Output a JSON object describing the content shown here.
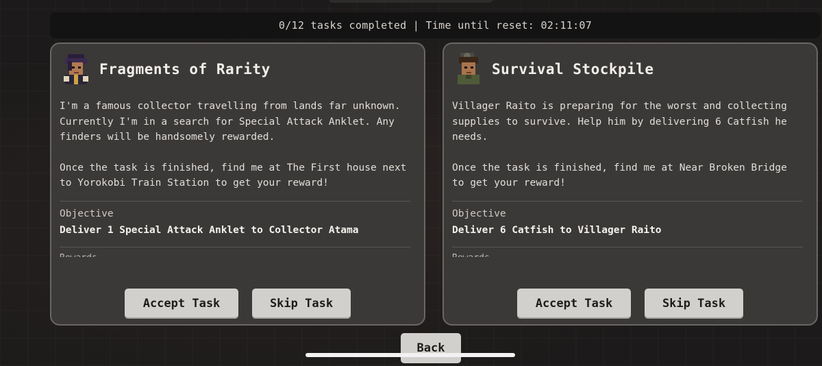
{
  "status": {
    "text": "0/12 tasks completed | Time until reset: 02:11:07"
  },
  "cards": [
    {
      "title": "Fragments of Rarity",
      "description": "I'm a famous collector travelling from lands far unknown. Currently I'm in a search for Special Attack Anklet. Any finders will be handsomely rewarded.",
      "location_text": "Once the task is finished, find me at The First house next to Yorokobi Train Station to get your reward!",
      "objective_label": "Objective",
      "objective": "Deliver 1 Special Attack Anklet to Collector Atama",
      "rewards_label": "Rewards",
      "accept_label": "Accept Task",
      "skip_label": "Skip Task",
      "avatar_icon": "collector-portrait-icon"
    },
    {
      "title": "Survival Stockpile",
      "description": "Villager Raito is preparing for the worst and collecting supplies to survive. Help him by delivering 6 Catfish he needs.",
      "location_text": "Once the task is finished, find me at Near Broken Bridge to get your reward!",
      "objective_label": "Objective",
      "objective": "Deliver 6 Catfish to Villager Raito",
      "rewards_label": "Rewards",
      "accept_label": "Accept Task",
      "skip_label": "Skip Task",
      "avatar_icon": "villager-portrait-icon"
    }
  ],
  "back_label": "Back",
  "colors": {
    "card_bg": "#3b3938",
    "card_border": "#6a6664",
    "button_bg": "#d2d0cd",
    "status_bg": "#141313"
  }
}
